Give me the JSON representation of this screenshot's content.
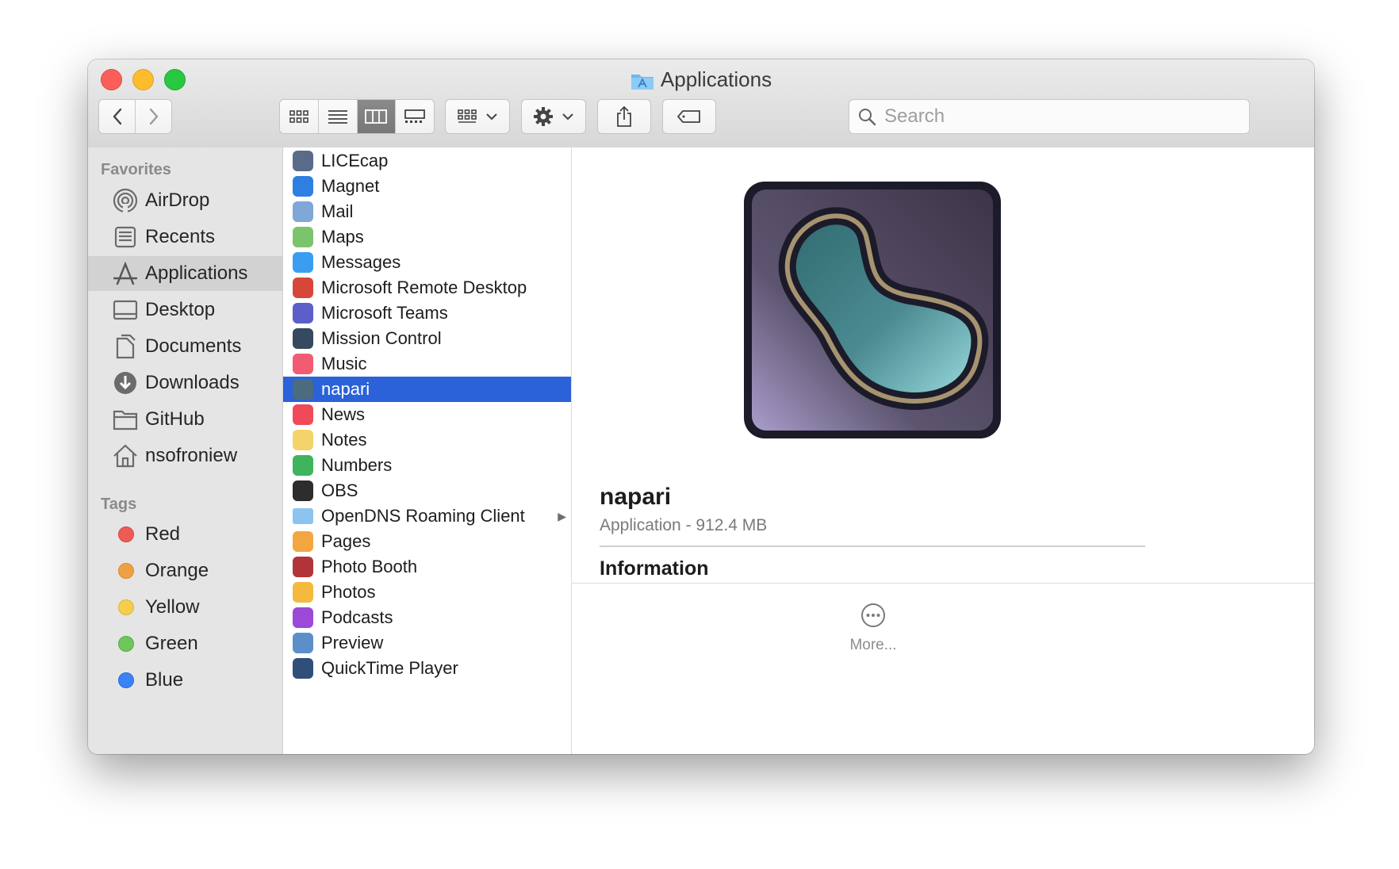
{
  "window": {
    "title": "Applications"
  },
  "toolbar": {
    "back_icon": "chevron-left-icon",
    "forward_icon": "chevron-right-icon",
    "view_modes": [
      "icon-view",
      "list-view",
      "column-view",
      "gallery-view"
    ],
    "active_view": "column-view",
    "search": {
      "placeholder": "Search",
      "value": ""
    }
  },
  "sidebar": {
    "favorites_heading": "Favorites",
    "favorites": [
      {
        "label": "AirDrop",
        "icon": "airdrop-icon"
      },
      {
        "label": "Recents",
        "icon": "recents-icon"
      },
      {
        "label": "Applications",
        "icon": "applications-icon",
        "selected": true
      },
      {
        "label": "Desktop",
        "icon": "desktop-icon"
      },
      {
        "label": "Documents",
        "icon": "documents-icon"
      },
      {
        "label": "Downloads",
        "icon": "downloads-icon"
      },
      {
        "label": "GitHub",
        "icon": "folder-icon"
      },
      {
        "label": "nsofroniew",
        "icon": "home-icon"
      }
    ],
    "tags_heading": "Tags",
    "tags": [
      {
        "label": "Red",
        "color": "#ee5b55"
      },
      {
        "label": "Orange",
        "color": "#f0a044"
      },
      {
        "label": "Yellow",
        "color": "#f5cf4c"
      },
      {
        "label": "Green",
        "color": "#6dc65c"
      },
      {
        "label": "Blue",
        "color": "#3b82f6"
      }
    ]
  },
  "files": [
    {
      "label": "LICEcap",
      "color": "#5a6b8a"
    },
    {
      "label": "Magnet",
      "color": "#2f7fe0"
    },
    {
      "label": "Mail",
      "color": "#7fa7d8"
    },
    {
      "label": "Maps",
      "color": "#7cc36e"
    },
    {
      "label": "Messages",
      "color": "#3b9df2"
    },
    {
      "label": "Microsoft Remote Desktop",
      "color": "#d6473a"
    },
    {
      "label": "Microsoft Teams",
      "color": "#5b5fc7"
    },
    {
      "label": "Mission Control",
      "color": "#35495f"
    },
    {
      "label": "Music",
      "color": "#f25c73"
    },
    {
      "label": "napari",
      "color": "#4b6b80",
      "selected": true
    },
    {
      "label": "News",
      "color": "#f04a5a"
    },
    {
      "label": "Notes",
      "color": "#f4d36b"
    },
    {
      "label": "Numbers",
      "color": "#3fb45c"
    },
    {
      "label": "OBS",
      "color": "#2d2d2d"
    },
    {
      "label": "OpenDNS Roaming Client",
      "color": "#8cc4ef",
      "folder": true
    },
    {
      "label": "Pages",
      "color": "#f3a640"
    },
    {
      "label": "Photo Booth",
      "color": "#b2333a"
    },
    {
      "label": "Photos",
      "color": "#f5b93f"
    },
    {
      "label": "Podcasts",
      "color": "#9b49d6"
    },
    {
      "label": "Preview",
      "color": "#5c8fc9"
    },
    {
      "label": "QuickTime Player",
      "color": "#2f4f79"
    }
  ],
  "preview": {
    "name": "napari",
    "meta": "Application - 912.4 MB",
    "info_heading": "Information",
    "more_label": "More..."
  }
}
